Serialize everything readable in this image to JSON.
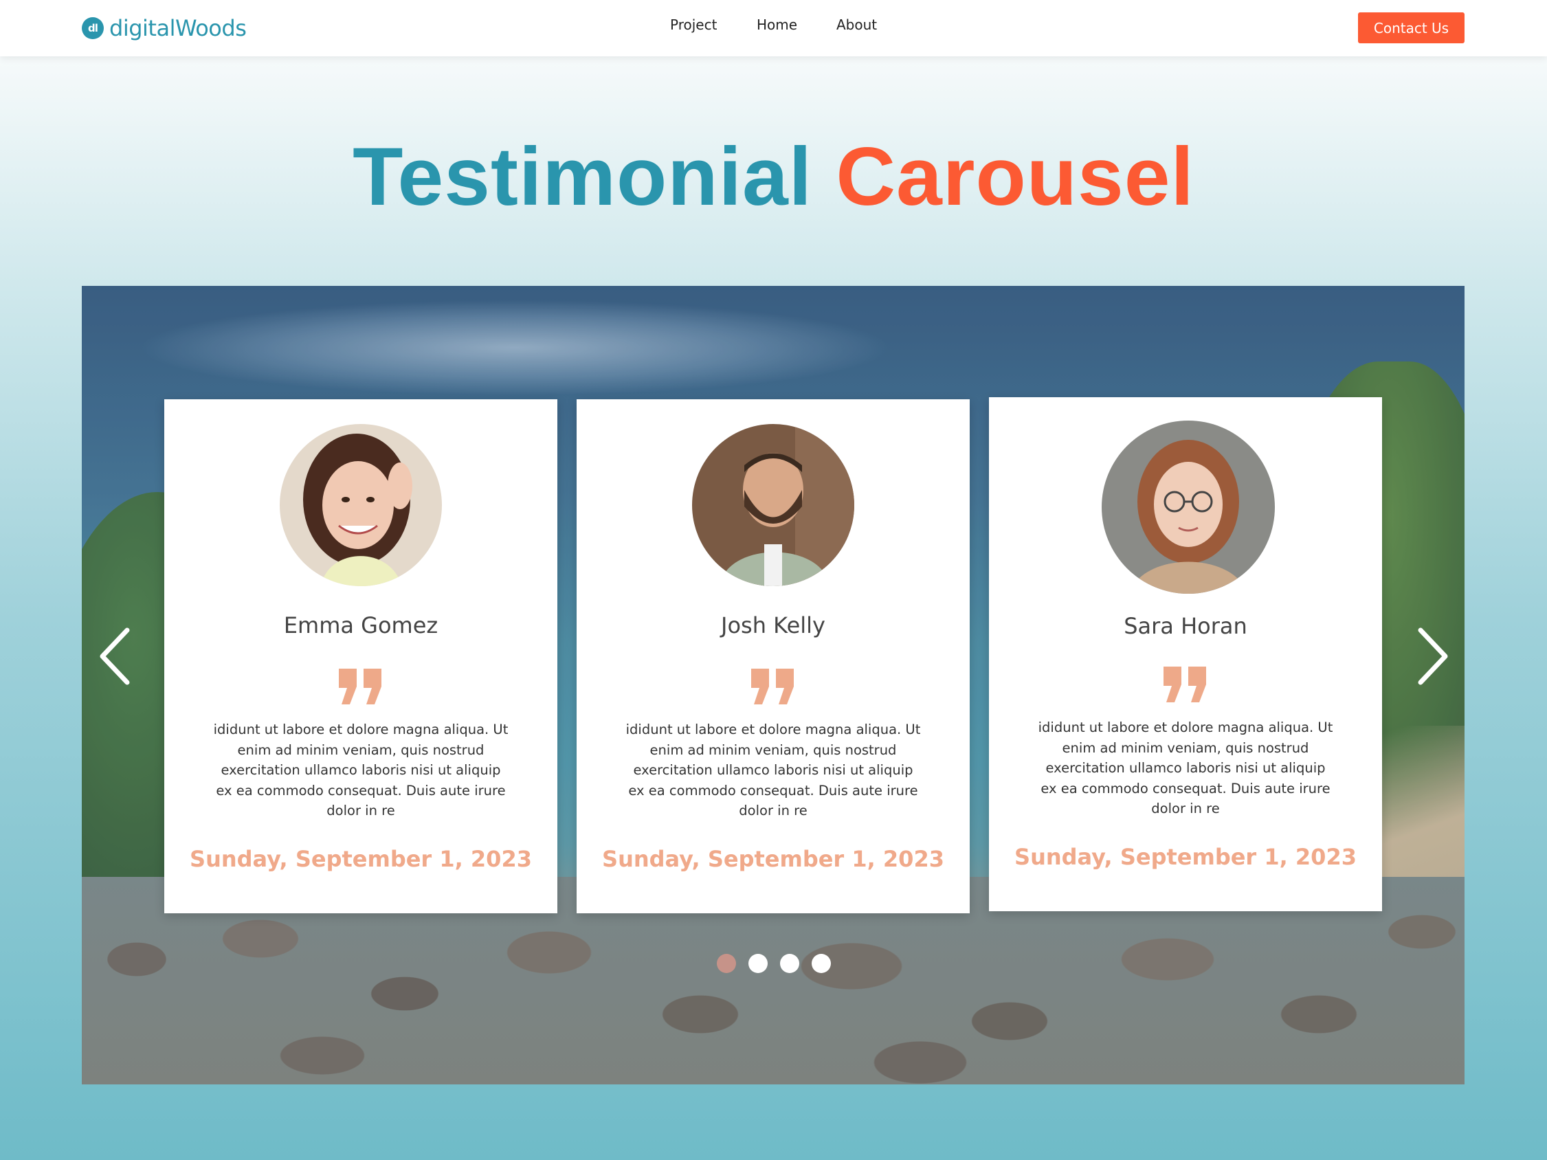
{
  "nav": {
    "logo_mark": "dl",
    "logo_text": "digitalWoods",
    "links": [
      "Project",
      "Home",
      "About"
    ],
    "contact_label": "Contact Us"
  },
  "title": {
    "part1": "Testimonial",
    "part2": "Carousel"
  },
  "colors": {
    "brand_teal": "#2a95ad",
    "accent_orange": "#fc5a33",
    "date_peach": "#f0a98a",
    "quote_peach": "#eea989"
  },
  "carousel": {
    "prev_icon": "chevron-left-icon",
    "next_icon": "chevron-right-icon",
    "dots_count": 4,
    "active_dot": 0,
    "cards": [
      {
        "name": "Emma Gomez",
        "text": "ididunt ut labore et dolore magna aliqua. Ut enim ad minim veniam, quis nostrud exercitation ullamco laboris nisi ut aliquip ex ea commodo consequat. Duis aute irure dolor in re",
        "date": "Sunday, September 1, 2023"
      },
      {
        "name": "Josh Kelly",
        "text": "ididunt ut labore et dolore magna aliqua. Ut enim ad minim veniam, quis nostrud exercitation ullamco laboris nisi ut aliquip ex ea commodo consequat. Duis aute irure dolor in re",
        "date": "Sunday, September 1, 2023"
      },
      {
        "name": "Sara Horan",
        "text": "ididunt ut labore et dolore magna aliqua. Ut enim ad minim veniam, quis nostrud exercitation ullamco laboris nisi ut aliquip ex ea commodo consequat. Duis aute irure dolor in re",
        "date": "Sunday, September 1, 2023"
      }
    ]
  }
}
